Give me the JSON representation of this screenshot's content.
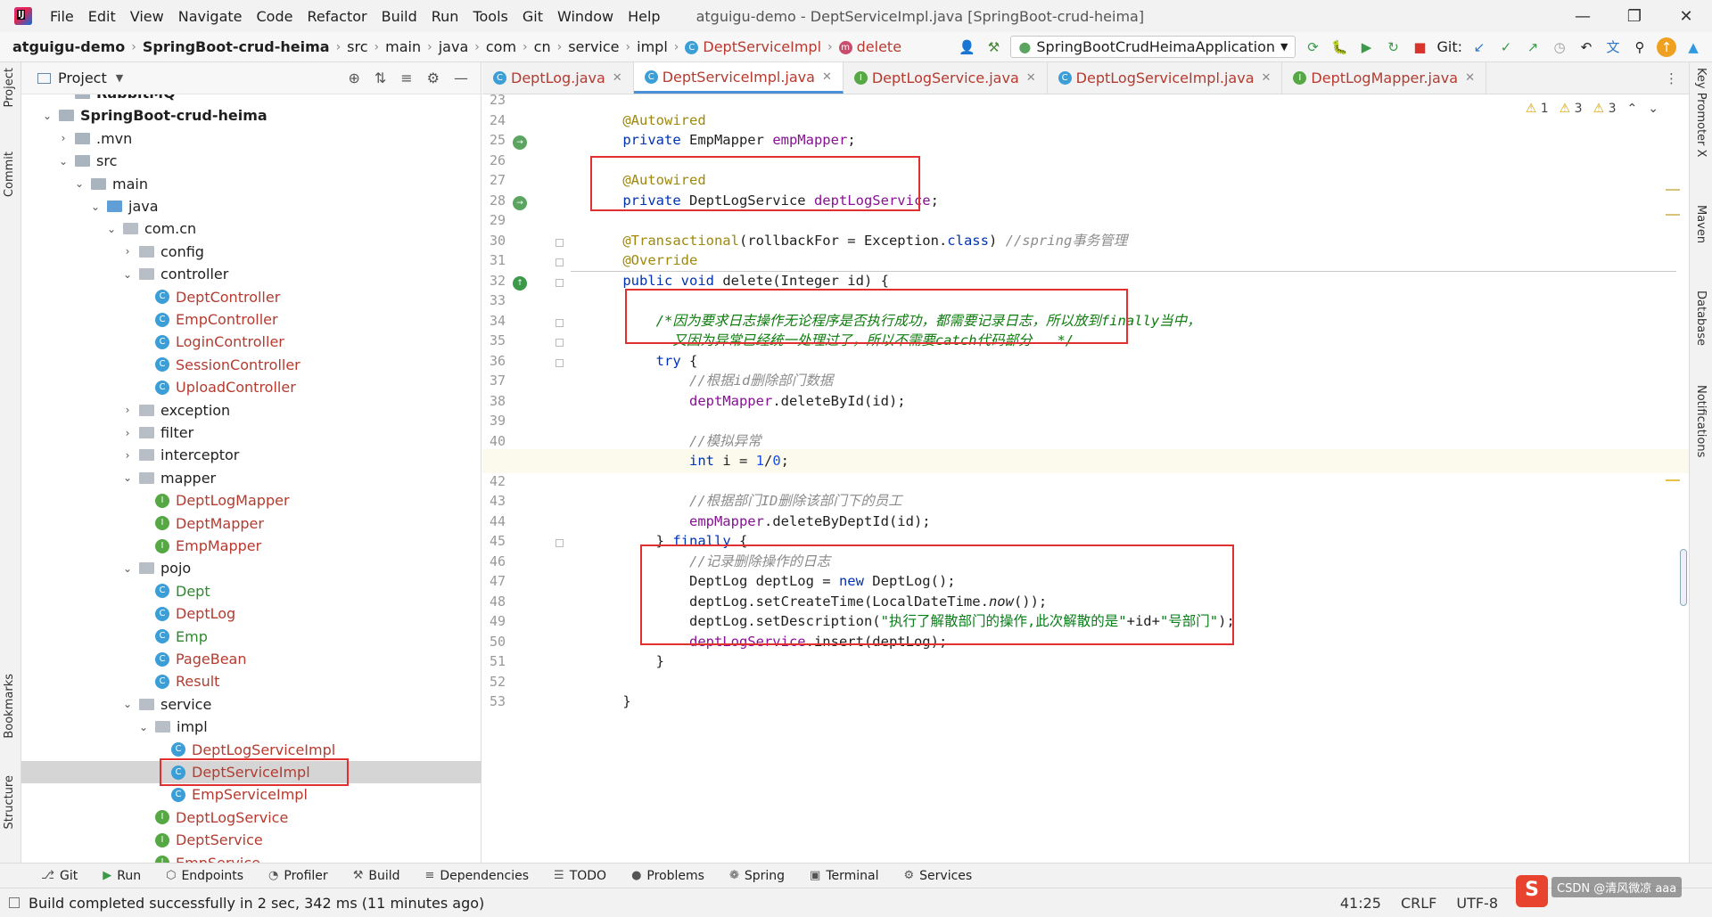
{
  "window": {
    "title": "atguigu-demo - DeptServiceImpl.java [SpringBoot-crud-heima]",
    "menu": [
      "File",
      "Edit",
      "View",
      "Navigate",
      "Code",
      "Refactor",
      "Build",
      "Run",
      "Tools",
      "Git",
      "Window",
      "Help"
    ]
  },
  "breadcrumb": {
    "items": [
      "atguigu-demo",
      "SpringBoot-crud-heima",
      "src",
      "main",
      "java",
      "com",
      "cn",
      "service",
      "impl"
    ],
    "class_name": "DeptServiceImpl",
    "method_name": "delete"
  },
  "toolbar": {
    "run_config": "SpringBootCrudHeimaApplication",
    "git_label": "Git:"
  },
  "left_strip": {
    "project": "Project",
    "commit": "Commit",
    "bookmarks": "Bookmarks",
    "structure": "Structure"
  },
  "right_strip": {
    "key_promoter": "Key Promoter X",
    "maven": "Maven",
    "database": "Database",
    "notifications": "Notifications"
  },
  "project_panel": {
    "title": "Project",
    "tree": [
      {
        "label": "RabbitMQ",
        "indent": 2,
        "type": "module",
        "arrow": "",
        "style": "bold",
        "partial": true
      },
      {
        "label": "SpringBoot-crud-heima",
        "indent": 1,
        "type": "module",
        "arrow": "down",
        "style": "bold"
      },
      {
        "label": ".mvn",
        "indent": 2,
        "type": "folder",
        "arrow": "right"
      },
      {
        "label": "src",
        "indent": 2,
        "type": "folder",
        "arrow": "down"
      },
      {
        "label": "main",
        "indent": 3,
        "type": "folder",
        "arrow": "down"
      },
      {
        "label": "java",
        "indent": 4,
        "type": "src",
        "arrow": "down"
      },
      {
        "label": "com.cn",
        "indent": 5,
        "type": "pkg",
        "arrow": "down"
      },
      {
        "label": "config",
        "indent": 6,
        "type": "pkg",
        "arrow": "right"
      },
      {
        "label": "controller",
        "indent": 6,
        "type": "pkg",
        "arrow": "down"
      },
      {
        "label": "DeptController",
        "indent": 7,
        "type": "class",
        "style": "red"
      },
      {
        "label": "EmpController",
        "indent": 7,
        "type": "class",
        "style": "red"
      },
      {
        "label": "LoginController",
        "indent": 7,
        "type": "class",
        "style": "red"
      },
      {
        "label": "SessionController",
        "indent": 7,
        "type": "class",
        "style": "red"
      },
      {
        "label": "UploadController",
        "indent": 7,
        "type": "class",
        "style": "red"
      },
      {
        "label": "exception",
        "indent": 6,
        "type": "pkg",
        "arrow": "right"
      },
      {
        "label": "filter",
        "indent": 6,
        "type": "pkg",
        "arrow": "right"
      },
      {
        "label": "interceptor",
        "indent": 6,
        "type": "pkg",
        "arrow": "right"
      },
      {
        "label": "mapper",
        "indent": 6,
        "type": "pkg",
        "arrow": "down"
      },
      {
        "label": "DeptLogMapper",
        "indent": 7,
        "type": "interface",
        "style": "red"
      },
      {
        "label": "DeptMapper",
        "indent": 7,
        "type": "interface",
        "style": "red"
      },
      {
        "label": "EmpMapper",
        "indent": 7,
        "type": "interface",
        "style": "red"
      },
      {
        "label": "pojo",
        "indent": 6,
        "type": "pkg",
        "arrow": "down"
      },
      {
        "label": "Dept",
        "indent": 7,
        "type": "class",
        "style": "green"
      },
      {
        "label": "DeptLog",
        "indent": 7,
        "type": "class",
        "style": "red"
      },
      {
        "label": "Emp",
        "indent": 7,
        "type": "class",
        "style": "green"
      },
      {
        "label": "PageBean",
        "indent": 7,
        "type": "class",
        "style": "red"
      },
      {
        "label": "Result",
        "indent": 7,
        "type": "class",
        "style": "red"
      },
      {
        "label": "service",
        "indent": 6,
        "type": "pkg",
        "arrow": "down"
      },
      {
        "label": "impl",
        "indent": 7,
        "type": "pkg",
        "arrow": "down"
      },
      {
        "label": "DeptLogServiceImpl",
        "indent": 8,
        "type": "class",
        "style": "red"
      },
      {
        "label": "DeptServiceImpl",
        "indent": 8,
        "type": "class",
        "style": "red",
        "selected": true
      },
      {
        "label": "EmpServiceImpl",
        "indent": 8,
        "type": "class",
        "style": "red"
      },
      {
        "label": "DeptLogService",
        "indent": 7,
        "type": "interface",
        "style": "red"
      },
      {
        "label": "DeptService",
        "indent": 7,
        "type": "interface",
        "style": "red"
      },
      {
        "label": "EmpService",
        "indent": 7,
        "type": "interface",
        "style": "red"
      }
    ]
  },
  "tabs": [
    {
      "label": "DeptLog.java",
      "icon": "C",
      "active": false,
      "close": true
    },
    {
      "label": "DeptServiceImpl.java",
      "icon": "C",
      "active": true,
      "close": true
    },
    {
      "label": "DeptLogService.java",
      "icon": "I",
      "active": false,
      "close": true
    },
    {
      "label": "DeptLogServiceImpl.java",
      "icon": "C",
      "active": false,
      "close": true
    },
    {
      "label": "DeptLogMapper.java",
      "icon": "I",
      "active": false,
      "close": true
    }
  ],
  "editor": {
    "badges": {
      "errors": "1",
      "warnings": "3",
      "weak": "3"
    },
    "first_line": 23,
    "current_line": 41,
    "lines": [
      [
        {
          "c": "t",
          "t": "    "
        }
      ],
      [
        {
          "c": "t",
          "t": "    "
        },
        {
          "c": "a",
          "t": "@Autowired"
        }
      ],
      [
        {
          "c": "t",
          "t": "    "
        },
        {
          "c": "k",
          "t": "private "
        },
        {
          "c": "t",
          "t": "EmpMapper "
        },
        {
          "c": "f",
          "t": "empMapper"
        },
        {
          "c": "t",
          "t": ";"
        }
      ],
      [
        {
          "c": "t",
          "t": ""
        }
      ],
      [
        {
          "c": "t",
          "t": "    "
        },
        {
          "c": "a",
          "t": "@Autowired"
        }
      ],
      [
        {
          "c": "t",
          "t": "    "
        },
        {
          "c": "k",
          "t": "private "
        },
        {
          "c": "t",
          "t": "DeptLogService "
        },
        {
          "c": "f",
          "t": "deptLogService"
        },
        {
          "c": "t",
          "t": ";"
        }
      ],
      [
        {
          "c": "t",
          "t": ""
        }
      ],
      [
        {
          "c": "t",
          "t": "    "
        },
        {
          "c": "a",
          "t": "@Transactional"
        },
        {
          "c": "t",
          "t": "(rollbackFor = Exception."
        },
        {
          "c": "k",
          "t": "class"
        },
        {
          "c": "t",
          "t": ") "
        },
        {
          "c": "cm",
          "t": "//spring事务管理"
        }
      ],
      [
        {
          "c": "t",
          "t": "    "
        },
        {
          "c": "a",
          "t": "@Override"
        }
      ],
      [
        {
          "c": "t",
          "t": "    "
        },
        {
          "c": "k",
          "t": "public void "
        },
        {
          "c": "t",
          "t": "delete(Integer id) {"
        }
      ],
      [
        {
          "c": "t",
          "t": ""
        }
      ],
      [
        {
          "c": "t",
          "t": "        "
        },
        {
          "c": "cmt",
          "t": "/*因为要求日志操作无论程序是否执行成功，都需要记录日志，所以放到finally当中，"
        }
      ],
      [
        {
          "c": "t",
          "t": "        "
        },
        {
          "c": "cmt",
          "t": "  又因为异常已经统一处理过了，所以不需要catch代码部分   */"
        }
      ],
      [
        {
          "c": "t",
          "t": "        "
        },
        {
          "c": "k",
          "t": "try "
        },
        {
          "c": "t",
          "t": "{"
        }
      ],
      [
        {
          "c": "t",
          "t": "            "
        },
        {
          "c": "cm",
          "t": "//根据id删除部门数据"
        }
      ],
      [
        {
          "c": "t",
          "t": "            "
        },
        {
          "c": "f",
          "t": "deptMapper"
        },
        {
          "c": "t",
          "t": ".deleteById(id);"
        }
      ],
      [
        {
          "c": "t",
          "t": ""
        }
      ],
      [
        {
          "c": "t",
          "t": "            "
        },
        {
          "c": "cm",
          "t": "//模拟异常"
        }
      ],
      [
        {
          "c": "t",
          "t": "            "
        },
        {
          "c": "k",
          "t": "int "
        },
        {
          "c": "t",
          "t": "i = "
        },
        {
          "c": "n",
          "t": "1"
        },
        {
          "c": "t",
          "t": "/"
        },
        {
          "c": "n",
          "t": "0"
        },
        {
          "c": "t",
          "t": ";"
        }
      ],
      [
        {
          "c": "t",
          "t": ""
        }
      ],
      [
        {
          "c": "t",
          "t": "            "
        },
        {
          "c": "cm",
          "t": "//根据部门ID删除该部门下的员工"
        }
      ],
      [
        {
          "c": "t",
          "t": "            "
        },
        {
          "c": "f",
          "t": "empMapper"
        },
        {
          "c": "t",
          "t": ".deleteByDeptId(id);"
        }
      ],
      [
        {
          "c": "t",
          "t": "        "
        },
        {
          "c": "t",
          "t": "} "
        },
        {
          "c": "k",
          "t": "finally "
        },
        {
          "c": "t",
          "t": "{"
        }
      ],
      [
        {
          "c": "t",
          "t": "            "
        },
        {
          "c": "cm",
          "t": "//记录删除操作的日志"
        }
      ],
      [
        {
          "c": "t",
          "t": "            "
        },
        {
          "c": "t",
          "t": "DeptLog deptLog = "
        },
        {
          "c": "k",
          "t": "new "
        },
        {
          "c": "t",
          "t": "DeptLog();"
        }
      ],
      [
        {
          "c": "t",
          "t": "            "
        },
        {
          "c": "t",
          "t": "deptLog.setCreateTime(LocalDateTime."
        },
        {
          "c": "it",
          "t": "now"
        },
        {
          "c": "t",
          "t": "());"
        }
      ],
      [
        {
          "c": "t",
          "t": "            "
        },
        {
          "c": "t",
          "t": "deptLog.setDescription("
        },
        {
          "c": "s",
          "t": "\"执行了解散部门的操作,此次解散的是\""
        },
        {
          "c": "t",
          "t": "+id+"
        },
        {
          "c": "s",
          "t": "\"号部门\""
        },
        {
          "c": "t",
          "t": ");"
        }
      ],
      [
        {
          "c": "t",
          "t": "            "
        },
        {
          "c": "f",
          "t": "deptLogService"
        },
        {
          "c": "t",
          "t": ".insert(deptLog);"
        }
      ],
      [
        {
          "c": "t",
          "t": "        "
        },
        {
          "c": "t",
          "t": "}"
        }
      ],
      [
        {
          "c": "t",
          "t": ""
        }
      ],
      [
        {
          "c": "t",
          "t": "    "
        },
        {
          "c": "t",
          "t": "}"
        }
      ]
    ]
  },
  "bottom_tools": [
    {
      "label": "Git",
      "icon": "git-icon"
    },
    {
      "label": "Run",
      "icon": "run-icon"
    },
    {
      "label": "Endpoints",
      "icon": "endpoints-icon"
    },
    {
      "label": "Profiler",
      "icon": "profiler-icon"
    },
    {
      "label": "Build",
      "icon": "build-icon"
    },
    {
      "label": "Dependencies",
      "icon": "dependencies-icon"
    },
    {
      "label": "TODO",
      "icon": "todo-icon"
    },
    {
      "label": "Problems",
      "icon": "problems-icon"
    },
    {
      "label": "Spring",
      "icon": "spring-icon"
    },
    {
      "label": "Terminal",
      "icon": "terminal-icon"
    },
    {
      "label": "Services",
      "icon": "services-icon"
    }
  ],
  "status": {
    "message": "Build completed successfully in 2 sec, 342 ms (11 minutes ago)",
    "position": "41:25",
    "line_sep": "CRLF",
    "encoding": "UTF-8"
  },
  "watermark": "CSDN @清风微凉 aaa"
}
